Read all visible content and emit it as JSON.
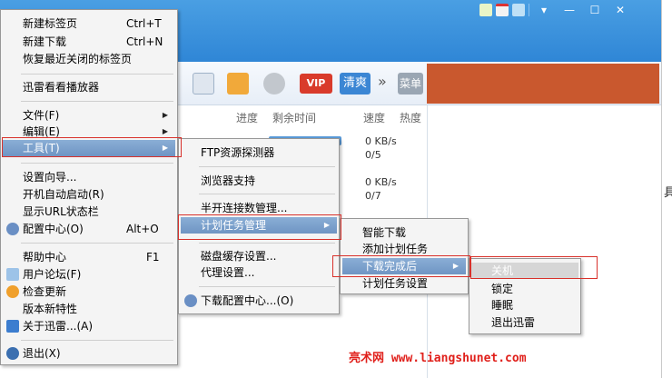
{
  "toolbar": {
    "vip_label": "VIP",
    "clean_label": "清爽",
    "more_label": "»",
    "menu_label": "菜单"
  },
  "columns": {
    "progress": "进度",
    "remaining": "剩余时间",
    "speed": "速度",
    "health": "热度"
  },
  "rows": [
    {
      "speed": "0 KB/s",
      "sources": "0/5"
    },
    {
      "speed": "0 KB/s",
      "sources": "0/7"
    }
  ],
  "edge_glyph": "具",
  "watermark": "亮术网 www.liangshunet.com",
  "main_menu": {
    "items": [
      {
        "label": "新建标签页",
        "shortcut": "Ctrl+T"
      },
      {
        "label": "新建下载",
        "shortcut": "Ctrl+N"
      },
      {
        "label": "恢复最近关闭的标签页"
      },
      {
        "label": "迅雷看看播放器"
      },
      {
        "label": "文件(F)"
      },
      {
        "label": "编辑(E)"
      },
      {
        "label": "工具(T)"
      },
      {
        "label": "设置向导..."
      },
      {
        "label": "开机自动启动(R)"
      },
      {
        "label": "显示URL状态栏"
      },
      {
        "label": "配置中心(O)",
        "shortcut": "Alt+O"
      },
      {
        "label": "帮助中心",
        "shortcut": "F1"
      },
      {
        "label": "用户论坛(F)"
      },
      {
        "label": "检查更新"
      },
      {
        "label": "版本新特性"
      },
      {
        "label": "关于迅雷...(A)"
      },
      {
        "label": "退出(X)"
      }
    ]
  },
  "tools_menu": {
    "items": [
      {
        "label": "FTP资源探测器"
      },
      {
        "label": "浏览器支持"
      },
      {
        "label": "半开连接数管理..."
      },
      {
        "label": "计划任务管理"
      },
      {
        "label": "磁盘缓存设置..."
      },
      {
        "label": "代理设置..."
      },
      {
        "label": "下载配置中心...(O)"
      }
    ]
  },
  "schedule_menu": {
    "items": [
      {
        "label": "智能下载"
      },
      {
        "label": "添加计划任务"
      },
      {
        "label": "下载完成后"
      },
      {
        "label": "计划任务设置"
      }
    ]
  },
  "after_download_menu": {
    "items": [
      {
        "label": "关机"
      },
      {
        "label": "锁定"
      },
      {
        "label": "睡眠"
      },
      {
        "label": "退出迅雷"
      }
    ]
  },
  "colors": {
    "titlebar": "#3a92dd",
    "highlight": "#7a9fcc",
    "annotation_red": "#d8312b"
  }
}
